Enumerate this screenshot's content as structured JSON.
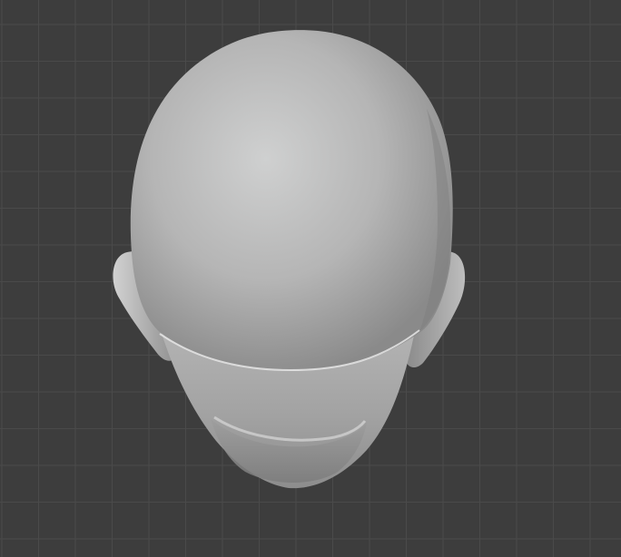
{
  "viewport": {
    "background_color": "#3d3d3d",
    "grid_color": "#4a4a4a",
    "grid_visible": true
  },
  "model": {
    "object": "head-sculpt",
    "view": "top",
    "shading": "solid",
    "base_color": "#a9a9a9",
    "highlight_color": "#cfd0d0",
    "shadow_color": "#6a6a6a"
  },
  "icons": {
    "canvas": "viewport-canvas",
    "mesh": "head-mesh-icon"
  }
}
